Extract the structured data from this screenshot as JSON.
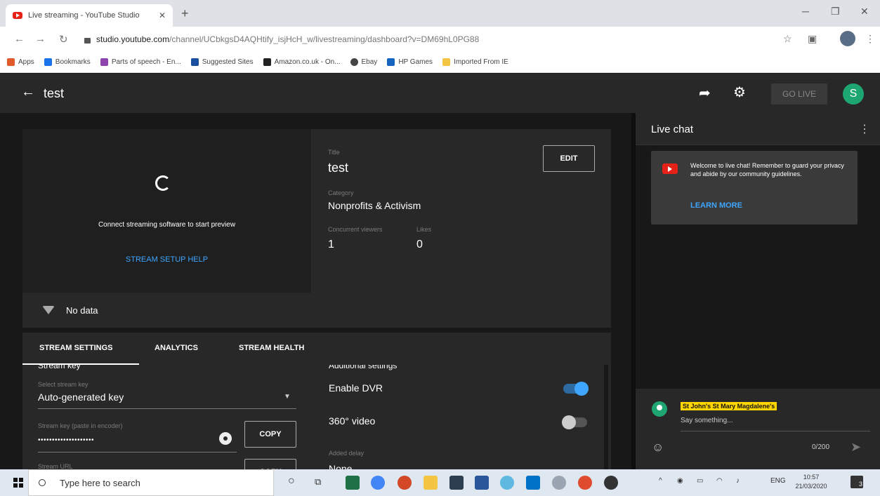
{
  "browser": {
    "tab_title": "Live streaming - YouTube Studio",
    "tab_close": "✕",
    "new_tab": "+",
    "url_host": "studio.youtube.com",
    "url_path": "/channel/UCbkgsD4AQHtify_isjHcH_w/livestreaming/dashboard?v=DM69hL0PG88",
    "bookmarks": [
      {
        "label": "Apps",
        "color": "#e05a2b"
      },
      {
        "label": "Bookmarks",
        "color": "#1a73e8"
      },
      {
        "label": "Parts of speech - En...",
        "color": "#8e44ad"
      },
      {
        "label": "Suggested Sites",
        "color": "#1a4fa0"
      },
      {
        "label": "Amazon.co.uk - On...",
        "color": "#222222"
      },
      {
        "label": "Ebay",
        "color": "#444444"
      },
      {
        "label": "HP Games",
        "color": "#1565c0"
      },
      {
        "label": "Imported From IE",
        "color": "#f4c542"
      }
    ]
  },
  "header": {
    "video_title": "test",
    "go_live": "GO LIVE",
    "avatar_letter": "S"
  },
  "preview": {
    "connect_text": "Connect streaming software to start preview",
    "setup_help": "STREAM SETUP HELP"
  },
  "info": {
    "title_label": "Title",
    "title_value": "test",
    "category_label": "Category",
    "category_value": "Nonprofits & Activism",
    "viewers_label": "Concurrent viewers",
    "viewers_value": "1",
    "likes_label": "Likes",
    "likes_value": "0",
    "edit_button": "EDIT"
  },
  "health": {
    "status": "No data"
  },
  "tabs": [
    "STREAM SETTINGS",
    "ANALYTICS",
    "STREAM HEALTH"
  ],
  "settings": {
    "stream_key_heading": "Stream key",
    "select_key_label": "Select stream key",
    "select_key_value": "Auto-generated key",
    "stream_key_label": "Stream key (paste in encoder)",
    "stream_key_value": "••••••••••••••••••••",
    "copy_label": "COPY",
    "stream_url_label": "Stream URL",
    "additional_heading": "Additional settings",
    "dvr_label": "Enable DVR",
    "dvr_on": true,
    "video360_label": "360° video",
    "video360_on": false,
    "delay_label": "Added delay",
    "delay_value": "None"
  },
  "chat": {
    "title": "Live chat",
    "welcome_text": "Welcome to live chat! Remember to guard your privacy and abide by our community guidelines.",
    "learn_more": "LEARN MORE",
    "user_name": "St John's St Mary Magdalene's",
    "placeholder": "Say something...",
    "counter": "0/200"
  },
  "taskbar": {
    "search_placeholder": "Type here to search",
    "lang": "ENG",
    "time": "10:57",
    "date": "21/03/2020",
    "notifications": "3"
  },
  "colors": {
    "accent_blue": "#3ea6ff",
    "brand_red": "#e62117",
    "avatar_green": "#1ea672",
    "chat_name_highlight": "#ffd600"
  }
}
